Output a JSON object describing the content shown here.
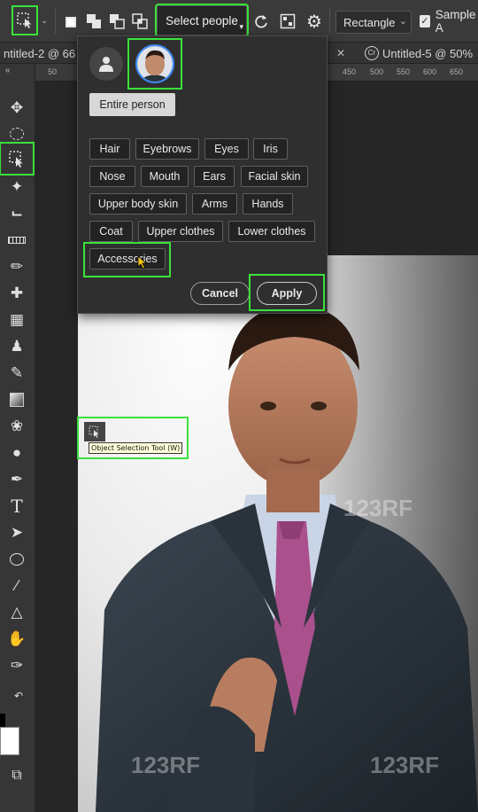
{
  "options_bar": {
    "select_people_label": "Select people",
    "mode_label": "Rectangle",
    "sample_label": "Sample A"
  },
  "tabs": [
    {
      "label": "ntitled-2 @ 66"
    },
    {
      "label": "Untitled-5 @ 50%"
    }
  ],
  "ruler": {
    "ticks": [
      "50",
      "450",
      "500",
      "550",
      "600",
      "650"
    ]
  },
  "people_panel": {
    "entire_person_label": "Entire person",
    "parts": [
      "Hair",
      "Eyebrows",
      "Eyes",
      "Iris",
      "Nose",
      "Mouth",
      "Ears",
      "Facial skin",
      "Upper body skin",
      "Arms",
      "Hands",
      "Coat",
      "Upper clothes",
      "Lower clothes",
      "Accessories"
    ],
    "cancel_label": "Cancel",
    "apply_label": "Apply"
  },
  "tooltip": {
    "text": "Object Selection Tool (W)"
  },
  "watermarks": [
    "123RF",
    "123RF",
    "123RF",
    "123RF"
  ],
  "colors": {
    "highlight": "#39e23a",
    "panel_bg": "#2f2f2f",
    "chip_bg": "#232323",
    "chip_border": "#5f5f5f",
    "entire_person_bg": "#d7d7d7"
  }
}
